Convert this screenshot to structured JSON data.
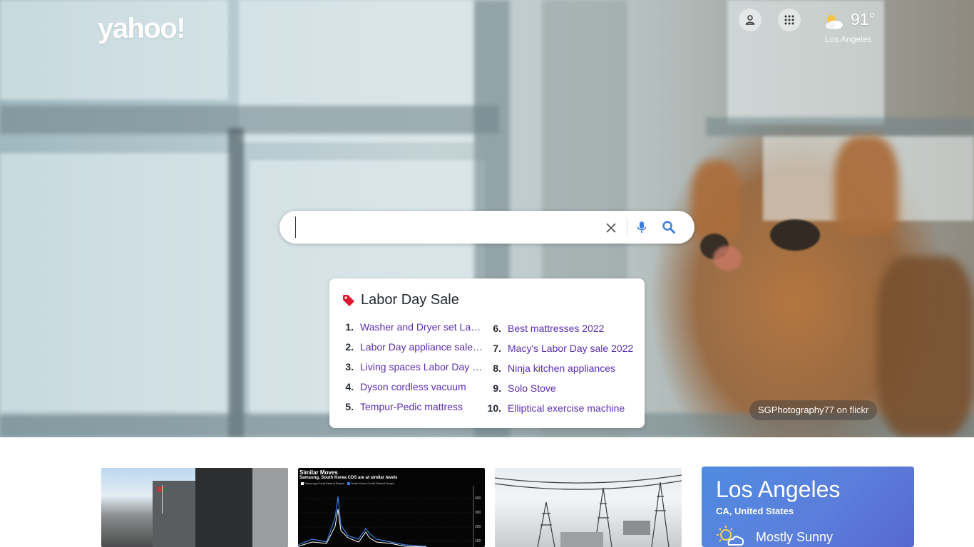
{
  "logo": {
    "text": "yahoo!"
  },
  "header": {
    "account_icon": "user-icon",
    "apps_icon": "grid-icon",
    "weather": {
      "icon": "partly-cloudy-icon",
      "temp": "91°",
      "city": "Los Angeles"
    }
  },
  "search": {
    "value": "",
    "placeholder": "",
    "clear_icon": "close-icon",
    "voice_icon": "microphone-icon",
    "search_icon": "search-icon"
  },
  "trending": {
    "title": "Labor Day Sale",
    "icon": "tag-icon",
    "items": [
      {
        "num": "1.",
        "label": "Washer and Dryer set Lab..."
      },
      {
        "num": "2.",
        "label": "Labor Day appliance sales..."
      },
      {
        "num": "3.",
        "label": "Living spaces Labor Day s..."
      },
      {
        "num": "4.",
        "label": "Dyson cordless vacuum"
      },
      {
        "num": "5.",
        "label": "Tempur-Pedic mattress"
      },
      {
        "num": "6.",
        "label": "Best mattresses 2022"
      },
      {
        "num": "7.",
        "label": "Macy's Labor Day sale 2022"
      },
      {
        "num": "8.",
        "label": "Ninja kitchen appliances"
      },
      {
        "num": "9.",
        "label": "Solo Stove"
      },
      {
        "num": "10.",
        "label": "Elliptical exercise machine"
      }
    ]
  },
  "photo_credit": {
    "author": "SGPhotography77",
    "source": "on flickr"
  },
  "news_cards": [
    {
      "name": "news-card-1"
    },
    {
      "name": "news-card-2",
      "caption_title": "Similar Moves",
      "caption_sub": "Samsung, South Korea CDS are at similar levels",
      "legend": [
        "Samsung Credit Default Swaps",
        "South Korea Credit Default Swaps"
      ],
      "ticks": [
        "400",
        "300",
        "200",
        "100"
      ]
    },
    {
      "name": "news-card-3"
    }
  ],
  "weather_card": {
    "city": "Los Angeles",
    "region": "CA, United States",
    "condition": "Mostly Sunny",
    "icon": "sun-cloud-icon"
  },
  "colors": {
    "link": "#5b2db0",
    "tag": "#e0182d",
    "weather_card": "#4f8be0"
  }
}
